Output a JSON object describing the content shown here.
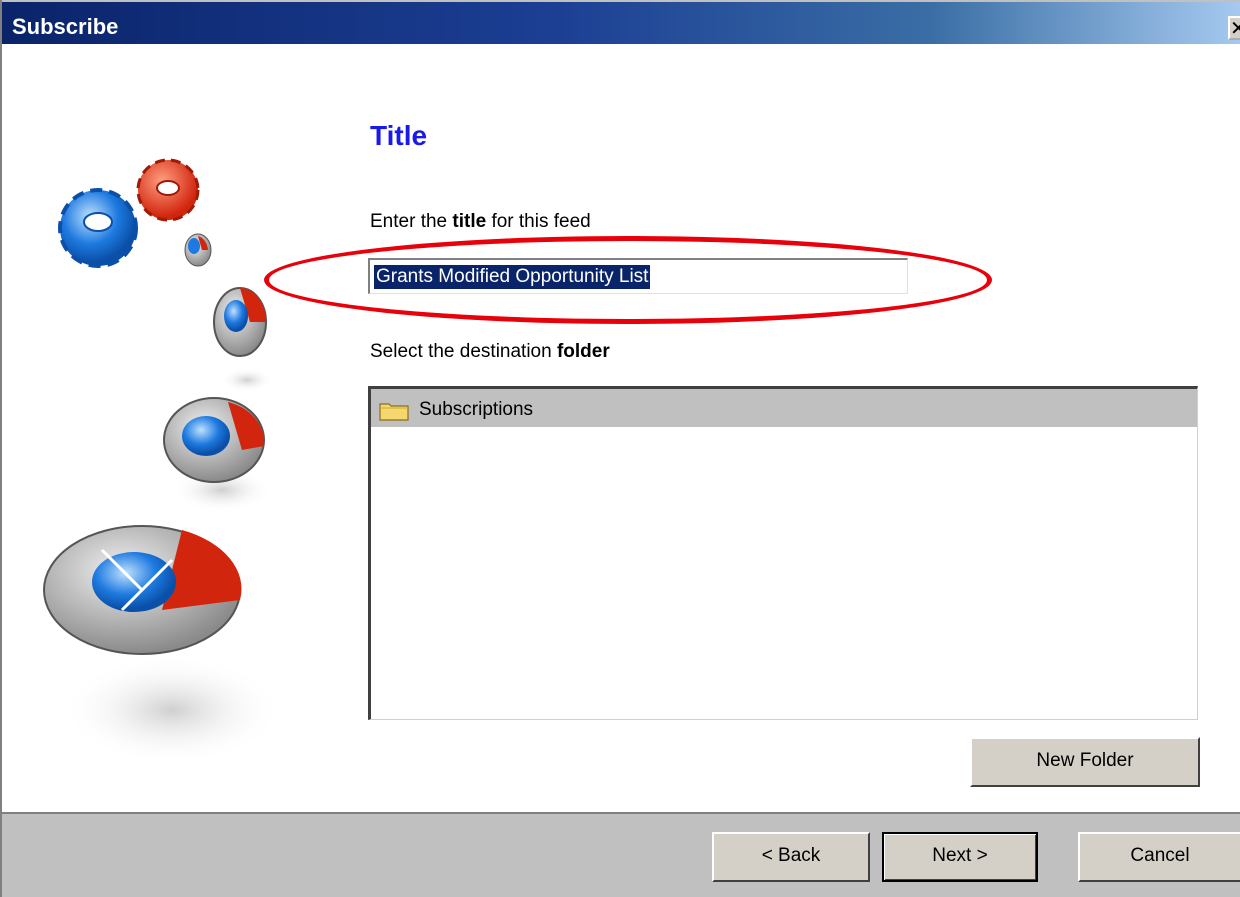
{
  "window": {
    "title": "Subscribe",
    "close_glyph": "✕"
  },
  "page": {
    "heading": "Title",
    "title_prompt": {
      "before": "Enter the ",
      "bold": "title",
      "after": " for this feed"
    },
    "title_value": "Grants Modified Opportunity List",
    "folder_prompt": {
      "before": "Select the destination ",
      "bold": "folder"
    },
    "folders": [
      {
        "label": "Subscriptions",
        "icon": "folder-icon",
        "selected": true
      }
    ],
    "new_folder_label": "New Folder"
  },
  "footer": {
    "back_label": "< Back",
    "next_label": "Next >",
    "cancel_label": "Cancel"
  },
  "colors": {
    "titlebar": "#0a246a",
    "heading": "#1a1ae6",
    "highlight": "#e8000a",
    "selection": "#0a246a",
    "footer": "#c0c0c0"
  }
}
